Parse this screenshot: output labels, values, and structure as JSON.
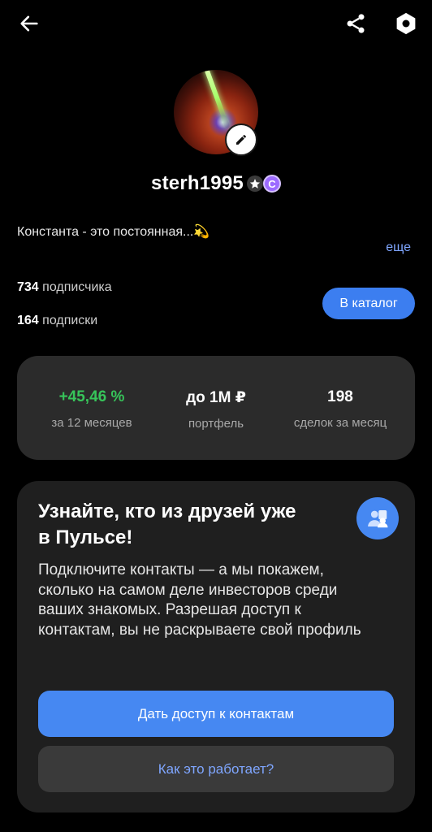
{
  "header": {
    "back_icon": "arrow-left-icon",
    "share_icon": "share-icon",
    "settings_icon": "hexagon-settings-icon"
  },
  "profile": {
    "username": "sterh1995",
    "bio": "Константа - это постоянная...💫",
    "more_label": "еще",
    "followers_count": "734",
    "followers_label": " подписчика",
    "following_count": "164",
    "following_label": " подписки",
    "catalog_button": "В каталог"
  },
  "stats": [
    {
      "value": "+45,46 %",
      "label": "за 12 месяцев",
      "color": "#37c45a"
    },
    {
      "value": "до 1М ₽",
      "label": "портфель"
    },
    {
      "value": "198",
      "label": "сделок за месяц"
    }
  ],
  "promo": {
    "title": "Узнайте, кто из друзей уже в Пульсе!",
    "text": "Подключите контакты — а мы покажем, сколько на самом деле инвесторов среди ваших знакомых. Разрешая доступ к контактам, вы не раскрываете свой профиль",
    "primary_button": "Дать доступ к контактам",
    "secondary_button": "Как это работает?",
    "icon": "contacts-icon"
  },
  "colors": {
    "accent": "#4688f2",
    "link": "#7fa6ff",
    "positive": "#37c45a",
    "background": "#000000",
    "card": "#2b2b2b"
  }
}
